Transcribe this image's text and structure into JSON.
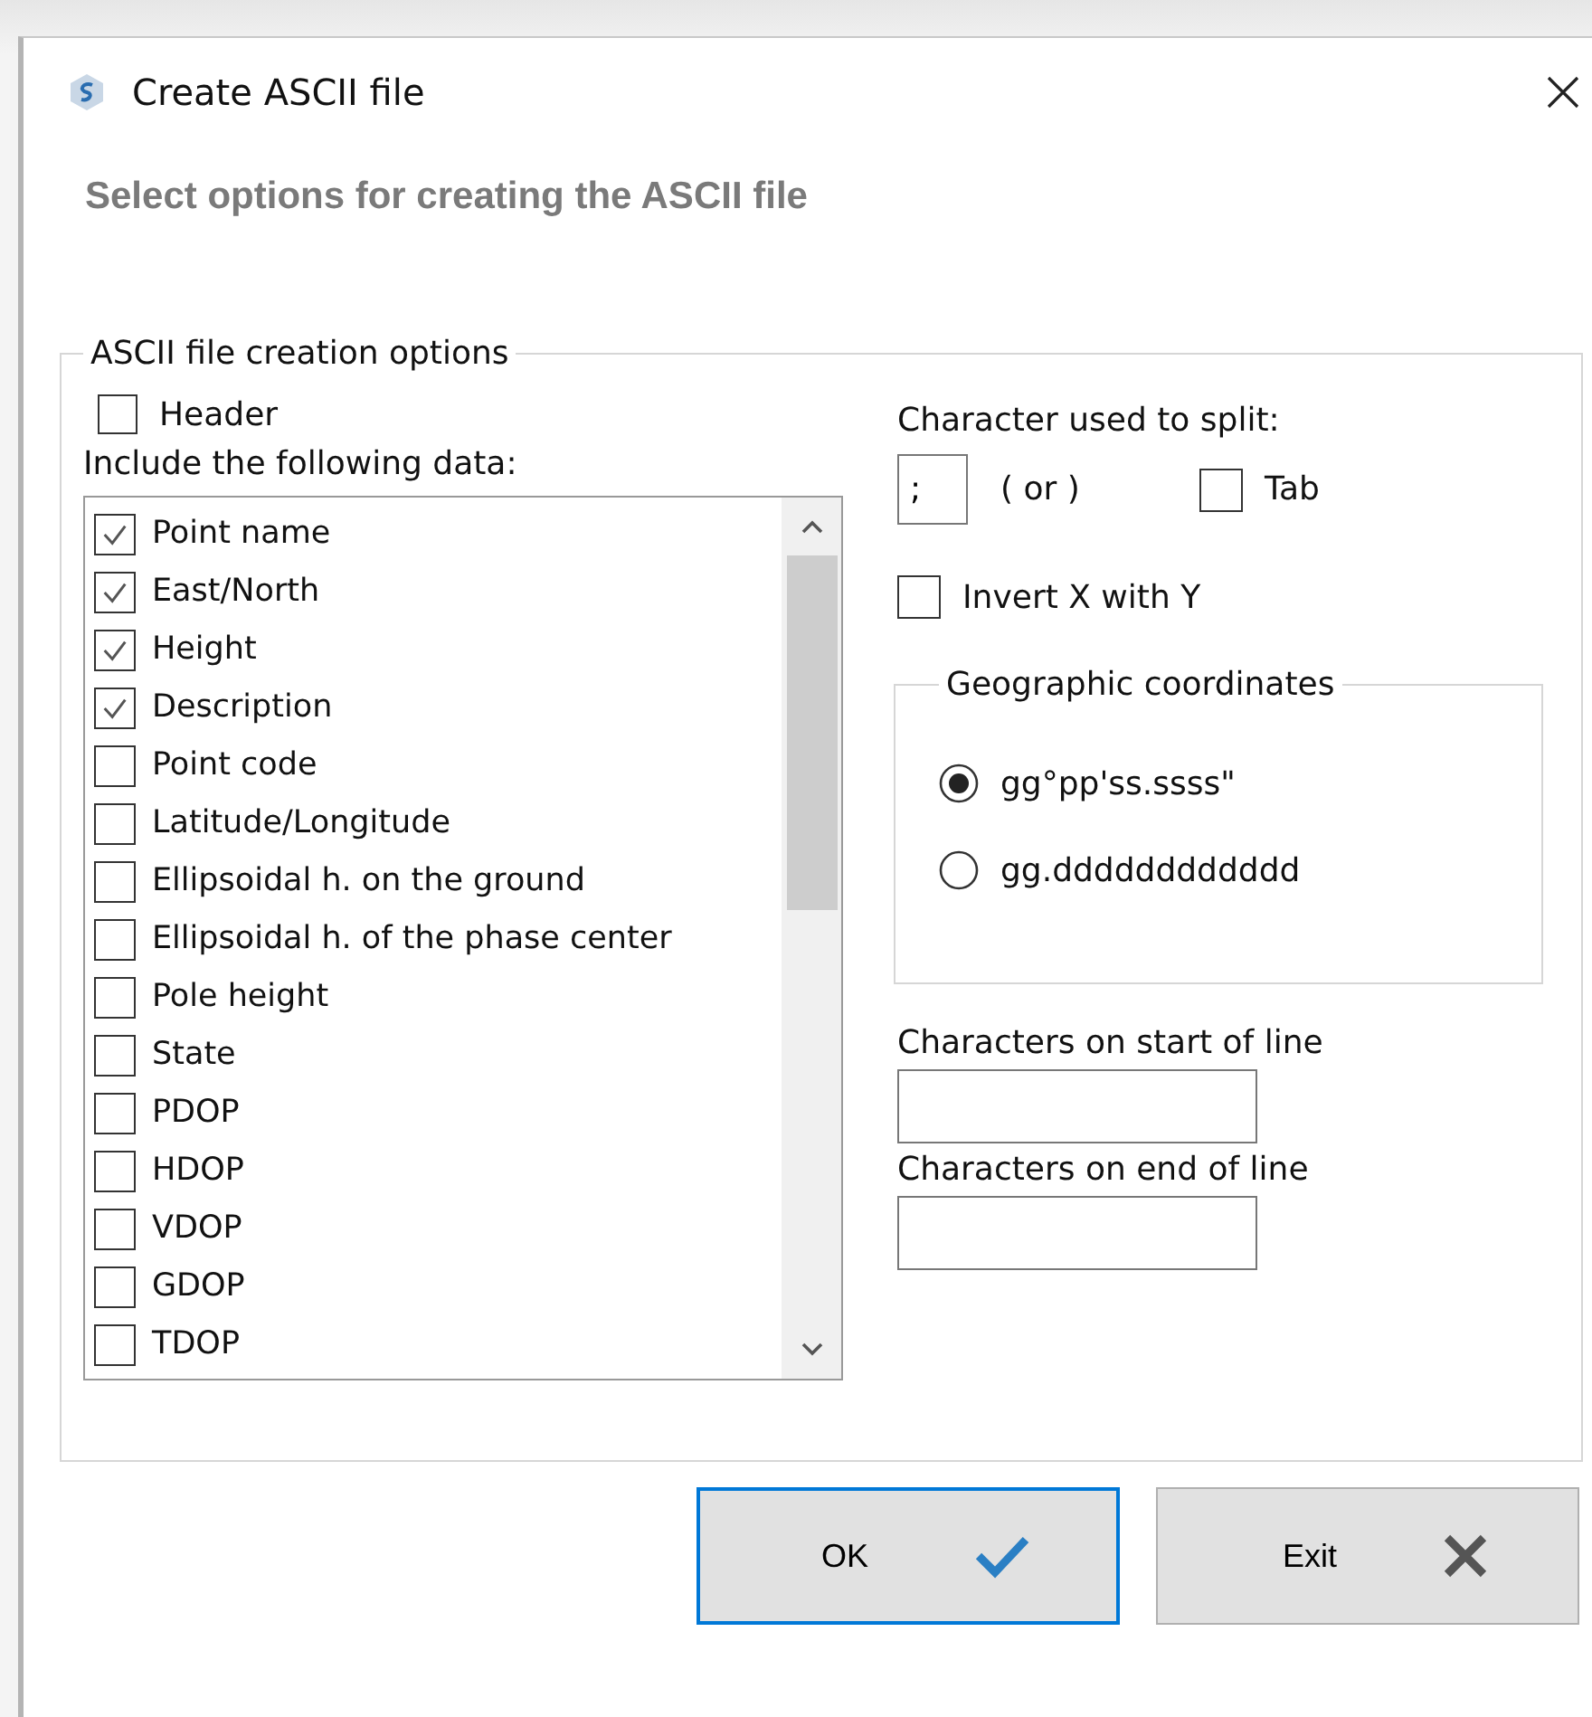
{
  "window": {
    "title": "Create ASCII file"
  },
  "subtitle": "Select options for creating the ASCII file",
  "options_group": {
    "legend": "ASCII file creation options",
    "header": {
      "label": "Header",
      "checked": false
    },
    "include_label": "Include the following data:",
    "data_items": [
      {
        "label": "Point name",
        "checked": true
      },
      {
        "label": "East/North",
        "checked": true
      },
      {
        "label": "Height",
        "checked": true
      },
      {
        "label": "Description",
        "checked": true
      },
      {
        "label": "Point code",
        "checked": false
      },
      {
        "label": "Latitude/Longitude",
        "checked": false
      },
      {
        "label": "Ellipsoidal h. on the ground",
        "checked": false
      },
      {
        "label": "Ellipsoidal h. of the phase center",
        "checked": false
      },
      {
        "label": "Pole height",
        "checked": false
      },
      {
        "label": "State",
        "checked": false
      },
      {
        "label": "PDOP",
        "checked": false
      },
      {
        "label": "HDOP",
        "checked": false
      },
      {
        "label": "VDOP",
        "checked": false
      },
      {
        "label": "GDOP",
        "checked": false
      },
      {
        "label": "TDOP",
        "checked": false
      }
    ],
    "split_label": "Character used to split:",
    "split_char": {
      "value": ";"
    },
    "or_label": "( or )",
    "tab": {
      "label": "Tab",
      "checked": false
    },
    "invert": {
      "label": "Invert X with Y",
      "checked": false
    },
    "geo_group": {
      "legend": "Geographic coordinates",
      "options": [
        {
          "label": "gg°pp'ss.ssss\"",
          "selected": true
        },
        {
          "label": "gg.dddddddddddd",
          "selected": false
        }
      ]
    },
    "start_label": "Characters on start of line",
    "end_label": "Characters on end of line"
  },
  "buttons": [
    {
      "label": "OK",
      "kind": "ok"
    },
    {
      "label": "Exit",
      "kind": "exit"
    }
  ]
}
